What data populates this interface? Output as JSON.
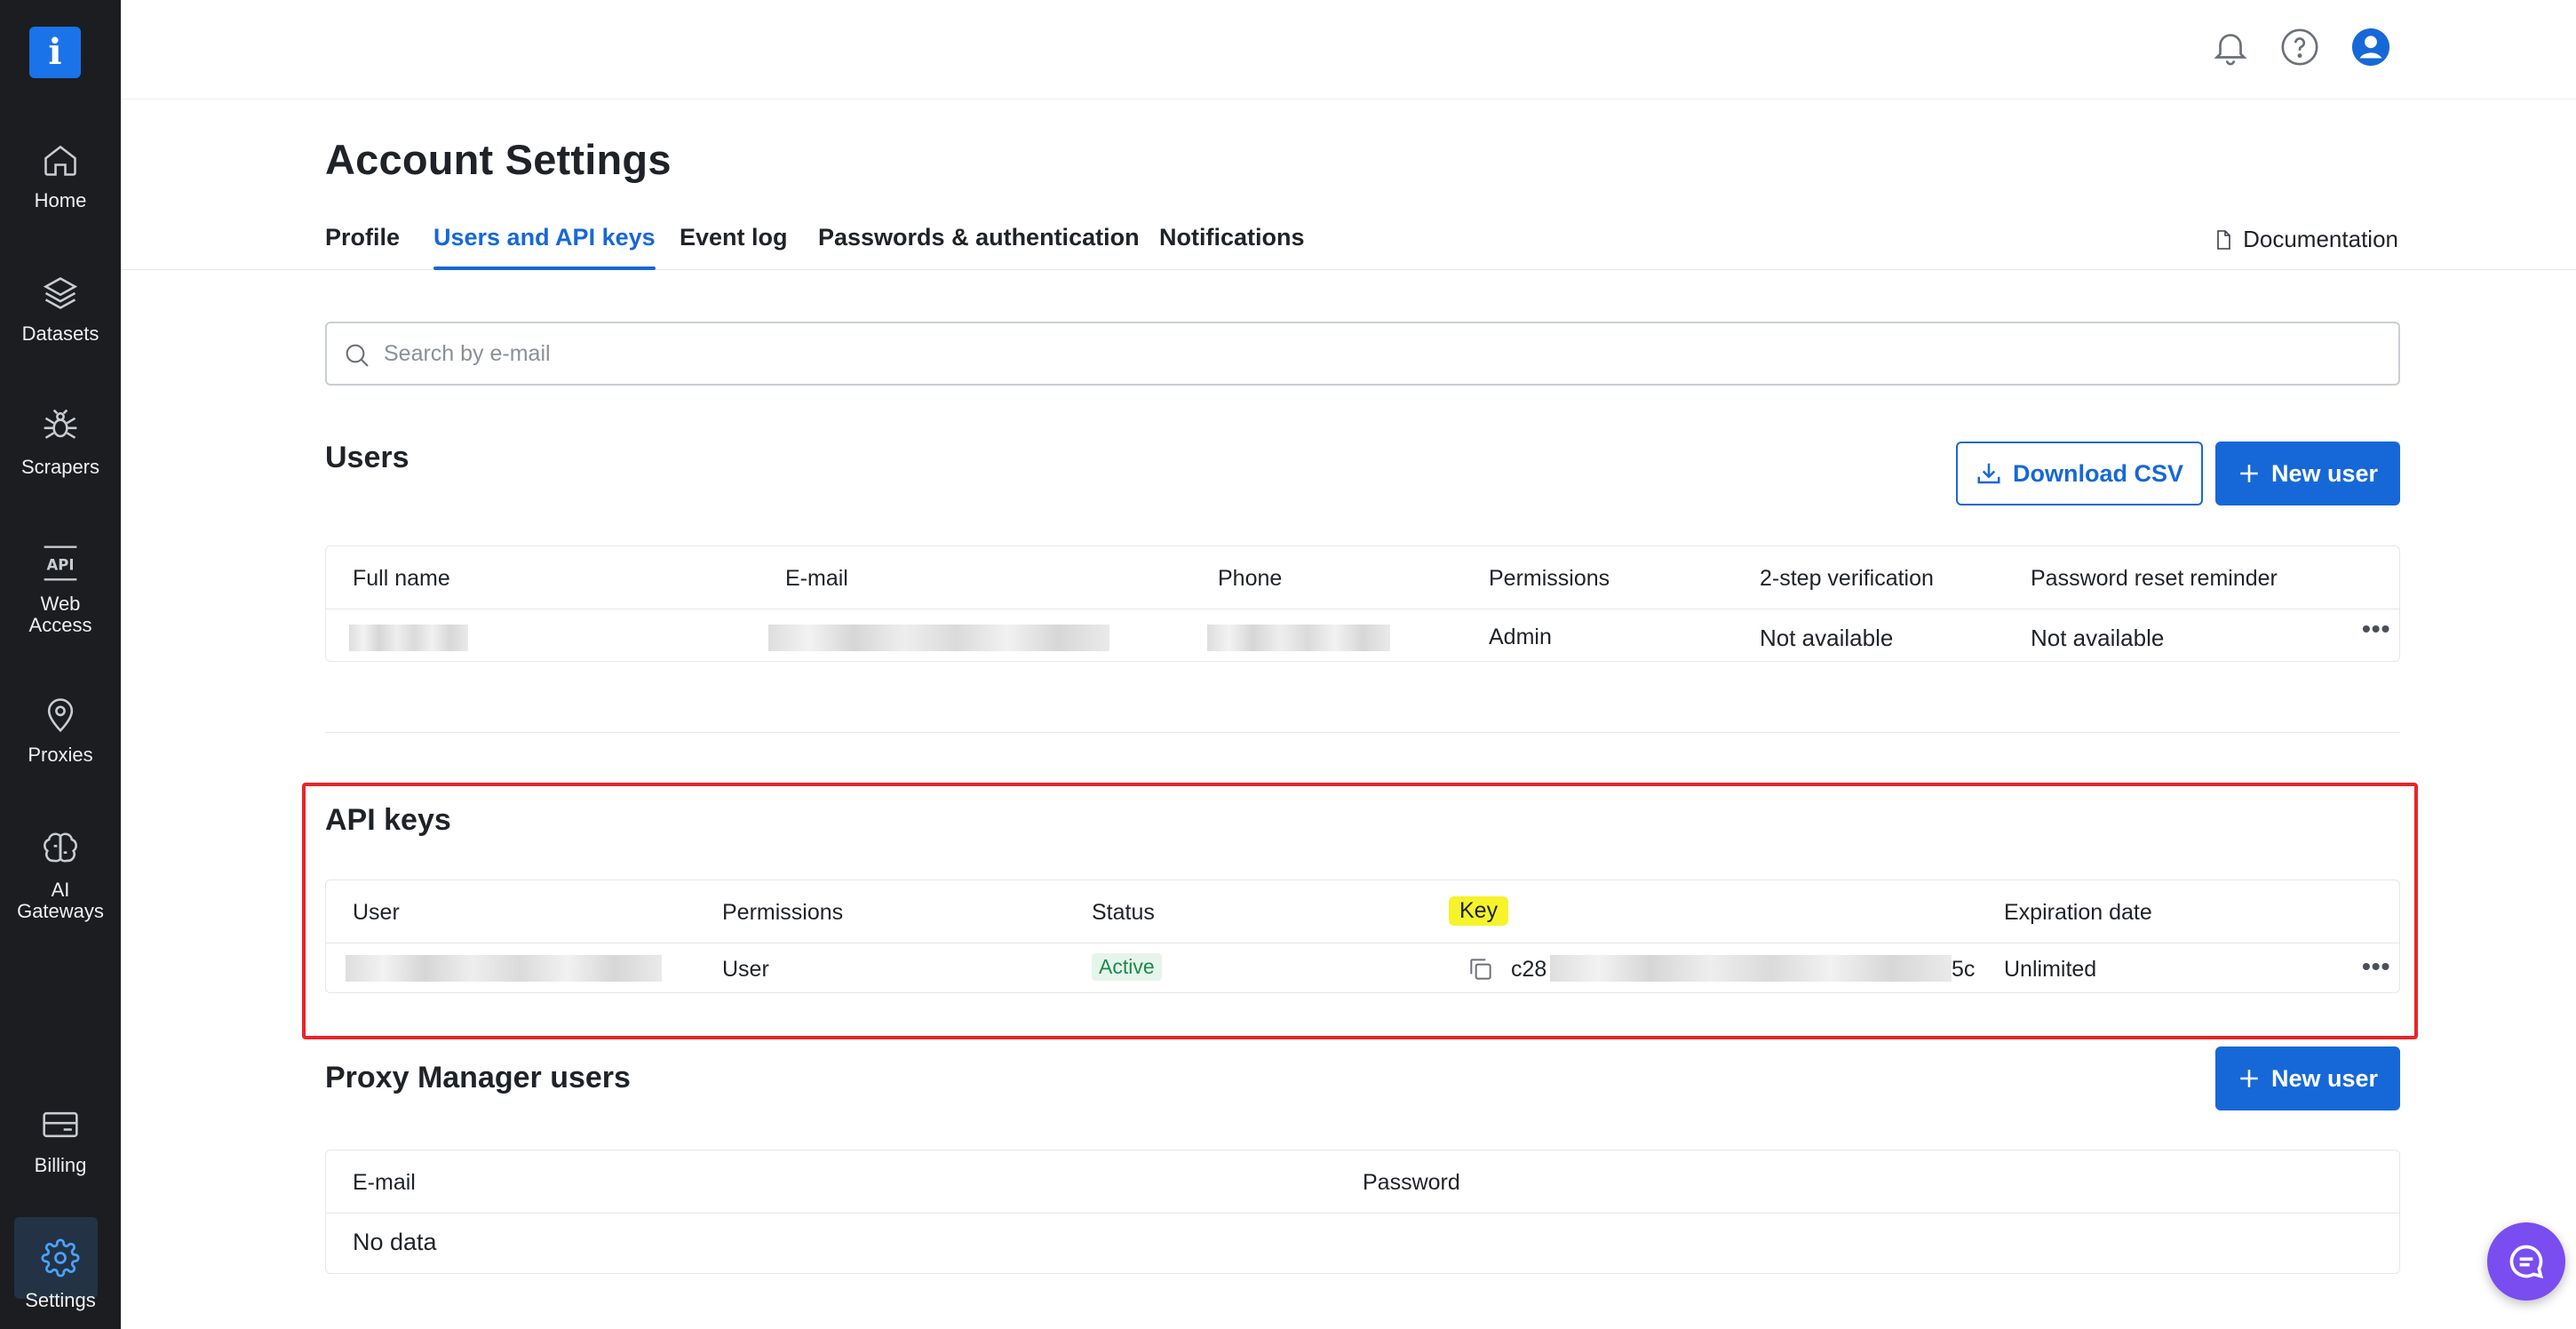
{
  "sidebar": {
    "logo": "i",
    "items": [
      {
        "label": "Home",
        "icon": "home-icon"
      },
      {
        "label": "Datasets",
        "icon": "layers-icon"
      },
      {
        "label": "Scrapers",
        "icon": "spider-icon"
      },
      {
        "label": "Web Access",
        "icon": "api-icon"
      },
      {
        "label": "Proxies",
        "icon": "location-pin-icon"
      },
      {
        "label": "AI Gateways",
        "icon": "brain-icon"
      },
      {
        "label": "Billing",
        "icon": "card-icon"
      },
      {
        "label": "Settings",
        "icon": "gear-icon",
        "active": true
      }
    ]
  },
  "header": {
    "icons": [
      "bell-icon",
      "help-icon",
      "user-avatar-icon"
    ]
  },
  "page": {
    "title": "Account Settings"
  },
  "tabs": [
    "Profile",
    "Users and API keys",
    "Event log",
    "Passwords & authentication",
    "Notifications"
  ],
  "active_tab": "Users and API keys",
  "documentation_link": "Documentation",
  "search": {
    "placeholder": "Search by e-mail",
    "value": ""
  },
  "users": {
    "title": "Users",
    "download_label": "Download CSV",
    "new_user_label": "New user",
    "columns": [
      "Full name",
      "E-mail",
      "Phone",
      "Permissions",
      "2-step verification",
      "Password reset reminder"
    ],
    "rows": [
      {
        "permissions": "Admin",
        "two_step": "Not available",
        "reset_reminder": "Not available"
      }
    ]
  },
  "api_keys": {
    "title": "API keys",
    "columns": [
      "User",
      "Permissions",
      "Status",
      "Key",
      "Expiration date"
    ],
    "rows": [
      {
        "permissions": "User",
        "status": "Active",
        "key_prefix": "c28",
        "key_suffix": "5c",
        "expiration": "Unlimited"
      }
    ]
  },
  "proxy_manager": {
    "title": "Proxy Manager users",
    "new_user_label": "New user",
    "columns": [
      "E-mail",
      "Password"
    ],
    "empty": "No data"
  },
  "colors": {
    "accent": "#1668d8",
    "sidebar": "#1b1d21",
    "highlight": "#e8242b",
    "key_highlight": "#f6f32a",
    "status_active": "#1e8a4c"
  }
}
